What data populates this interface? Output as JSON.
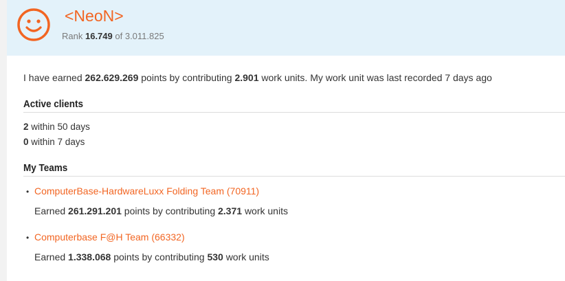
{
  "colors": {
    "accent": "#f26522",
    "header_bg": "#e3f2fa"
  },
  "profile": {
    "username": "<NeoN>",
    "avatar_icon": "smiley-face-icon",
    "rank_label": "Rank",
    "rank_value": "16.749",
    "rank_of": "of",
    "rank_total": "3.011.825"
  },
  "summary": {
    "text1": "I have earned",
    "points": "262.629.269",
    "text2": "points by contributing",
    "work_units": "2.901",
    "text3": "work units. My work unit was last recorded 7 days ago"
  },
  "active_clients": {
    "title": "Active clients",
    "lines": [
      {
        "count": "2",
        "text": "within 50 days"
      },
      {
        "count": "0",
        "text": "within 7 days"
      }
    ]
  },
  "teams": {
    "title": "My Teams",
    "items": [
      {
        "name": "ComputerBase-HardwareLuxx Folding Team (70911)",
        "earned_label": "Earned",
        "points": "261.291.201",
        "mid": "points by contributing",
        "units": "2.371",
        "end": "work units"
      },
      {
        "name": "Computerbase F@H Team (66332)",
        "earned_label": "Earned",
        "points": "1.338.068",
        "mid": "points by contributing",
        "units": "530",
        "end": "work units"
      }
    ]
  }
}
